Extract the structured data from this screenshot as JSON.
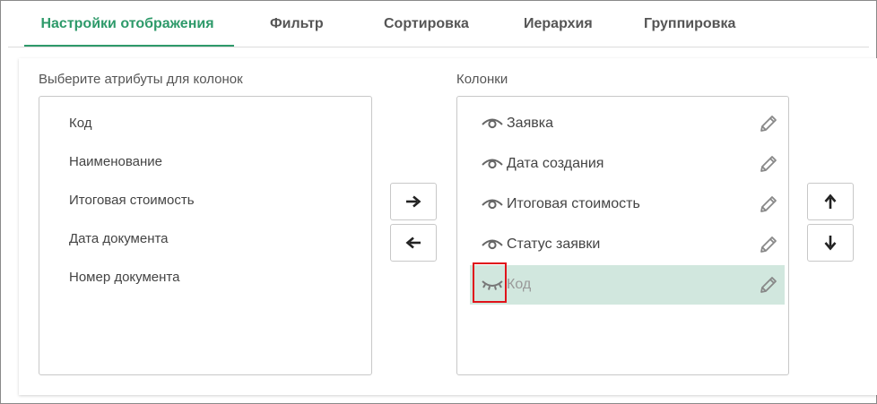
{
  "tabs": [
    {
      "label": "Настройки отображения",
      "active": true
    },
    {
      "label": "Фильтр",
      "active": false
    },
    {
      "label": "Сортировка",
      "active": false
    },
    {
      "label": "Иерархия",
      "active": false
    },
    {
      "label": "Группировка",
      "active": false
    }
  ],
  "available": {
    "label": "Выберите атрибуты для колонок",
    "items": [
      "Код",
      "Наименование",
      "Итоговая стоимость",
      "Дата документа",
      "Номер документа"
    ]
  },
  "columns": {
    "label": "Колонки",
    "items": [
      {
        "label": "Заявка",
        "visible": true,
        "selected": false
      },
      {
        "label": "Дата создания",
        "visible": true,
        "selected": false
      },
      {
        "label": "Итоговая стоимость",
        "visible": true,
        "selected": false
      },
      {
        "label": "Статус заявки",
        "visible": true,
        "selected": false
      },
      {
        "label": "Код",
        "visible": false,
        "selected": true
      }
    ]
  },
  "colors": {
    "accent": "#2e9a6a",
    "selected_row": "#d1e7de",
    "highlight": "#e0131b"
  },
  "icons": {
    "move_right": "arrow-right-icon",
    "move_left": "arrow-left-icon",
    "move_up": "arrow-up-icon",
    "move_down": "arrow-down-icon",
    "visible": "eye-icon",
    "hidden": "eye-closed-icon",
    "edit": "pencil-icon"
  }
}
